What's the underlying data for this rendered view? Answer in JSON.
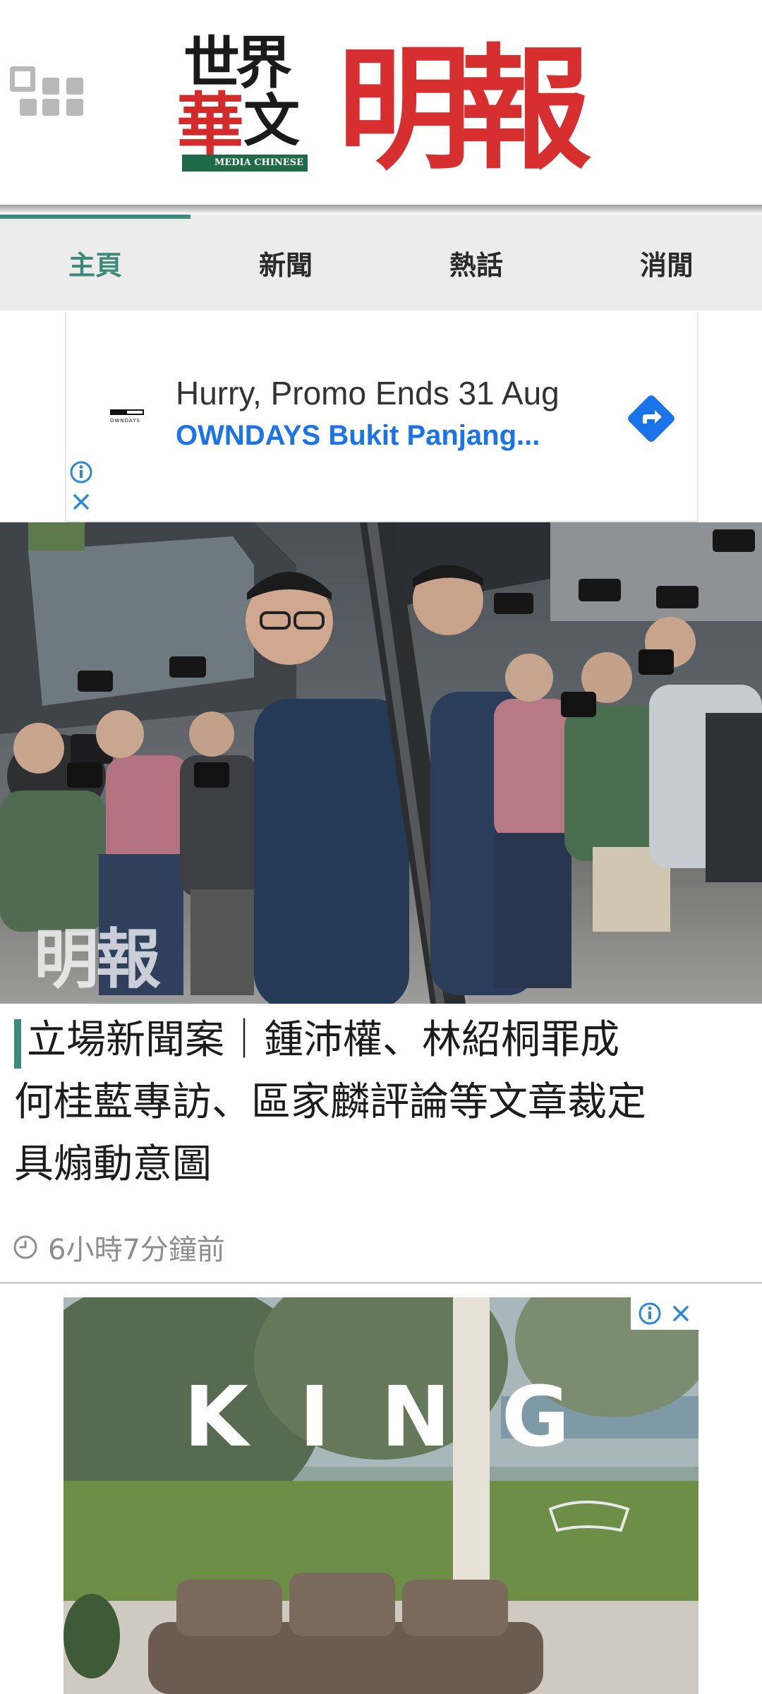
{
  "header": {
    "menu_icon": "grid-menu-icon",
    "logo_world": {
      "row1": "世界",
      "hua": "華",
      "wen": "文",
      "bar": "MEDIA CHINESE"
    },
    "logo_mingpao": "明報"
  },
  "tabs": [
    {
      "label": "主頁",
      "active": true
    },
    {
      "label": "新聞",
      "active": false
    },
    {
      "label": "熱話",
      "active": false
    },
    {
      "label": "消閒",
      "active": false
    }
  ],
  "ad_banner": {
    "brand": "OWNDAYS",
    "headline": "Hurry, Promo Ends 31 Aug",
    "subline": "OWNDAYS Bukit Panjang...",
    "accent_color": "#1a73e8",
    "icons": [
      "directions-arrow-icon",
      "info-icon",
      "close-icon"
    ]
  },
  "hero": {
    "watermark": "明報"
  },
  "article": {
    "title_line1": "立場新聞案｜鍾沛權、林紹桐罪成",
    "title_line2": "何桂藍專訪、區家麟評論等文章裁定",
    "title_line3": "具煽動意圖",
    "time": "6小時7分鐘前",
    "accent_color": "#3d8a7a"
  },
  "ad2": {
    "brand_text": "KING",
    "icons": [
      "info-icon",
      "close-icon"
    ]
  }
}
